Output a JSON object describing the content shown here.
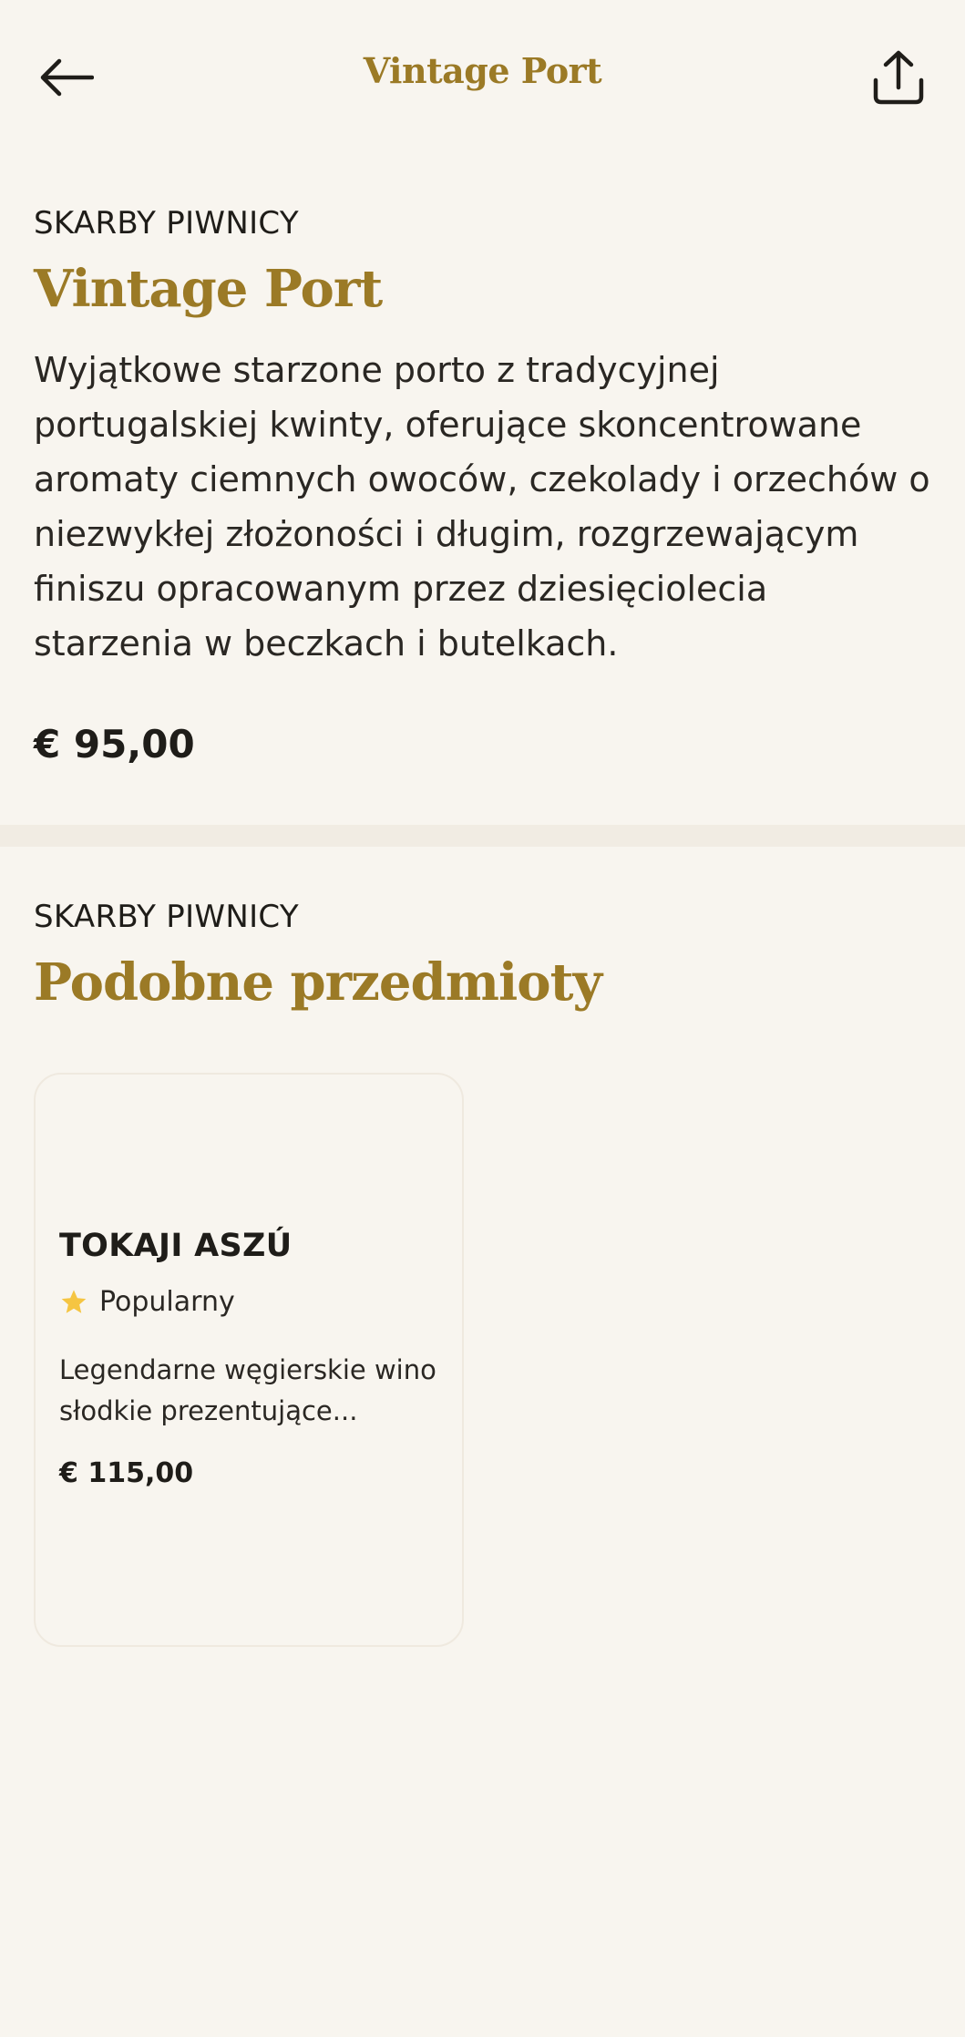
{
  "header": {
    "title": "Vintage Port",
    "back_icon": "arrow-left-icon",
    "share_icon": "share-icon"
  },
  "product": {
    "category": "SKARBY PIWNICY",
    "name": "Vintage Port",
    "description": "Wyjątkowe starzone porto z tradycyjnej portugalskiej kwinty, oferujące skoncentrowane aromaty ciemnych owoców, czekolady i orzechów o niezwykłej złożoności i długim, rozgrzewającym finiszu opracowanym przez dziesięciolecia starzenia w beczkach i butelkach.",
    "price": "€ 95,00"
  },
  "similar": {
    "category": "SKARBY PIWNICY",
    "title": "Podobne przedmioty",
    "items": [
      {
        "name": "TOKAJI ASZÚ",
        "badge": "Popularny",
        "badge_icon": "star-icon",
        "description": "Legendarne węgierskie wino słodkie prezentujące...",
        "price": "€ 115,00"
      }
    ]
  },
  "colors": {
    "background": "#f8f5ef",
    "accent": "#9b7a26",
    "star": "#f5c542",
    "text": "#1f1d19"
  }
}
